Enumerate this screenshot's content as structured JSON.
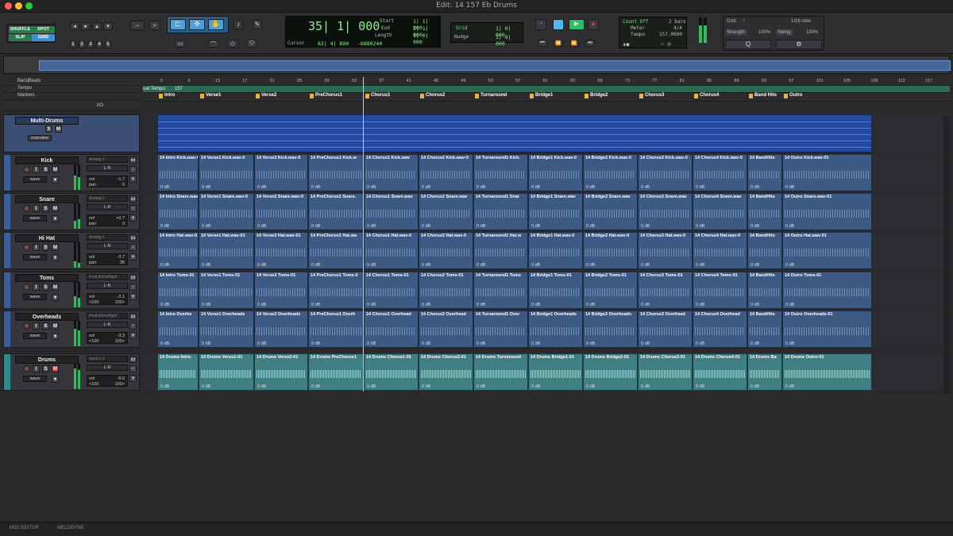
{
  "window": {
    "title": "Edit: 14 157 Eb Drums"
  },
  "modes": [
    "SHUFFLE",
    "SPOT",
    "SLIP",
    "GRID"
  ],
  "grid_numbers": [
    "1",
    "2",
    "3",
    "4",
    "5"
  ],
  "counter": {
    "main": "35| 1| 000",
    "start_label": "Start",
    "start": "1| 1| 000",
    "end_label": "End",
    "end": "2| 1| 000",
    "length_label": "Length",
    "length": "1| 0| 000",
    "cursor_label": "Cursor",
    "cursor_val": "62| 4| 890",
    "sample": "-6880244"
  },
  "grid": {
    "label": "Grid",
    "value": "1| 0| 000",
    "nudge_label": "Nudge",
    "nudge_value": "1| 0| 000"
  },
  "transport": {
    "count_off": "Count Off",
    "bars": "2 bars",
    "meter_label": "Meter",
    "meter": "4/4",
    "tempo_label": "Tempo",
    "tempo": "157.0000"
  },
  "quantize": {
    "grid_label": "Grid:",
    "grid_value": "1/16 note",
    "strength_label": "Strength:",
    "strength": "100%",
    "swing_label": "Swing:",
    "swing": "100%"
  },
  "rulers": {
    "bars_beats": "Bars|Beats",
    "tempo": "Tempo",
    "markers": "Markers",
    "tempo_text": "ual Tempo:",
    "tempo_val": "157"
  },
  "bar_numbers": [
    "5",
    "9",
    "13",
    "17",
    "21",
    "25",
    "29",
    "33",
    "37",
    "41",
    "45",
    "49",
    "53",
    "57",
    "61",
    "65",
    "69",
    "73",
    "77",
    "81",
    "85",
    "89",
    "93",
    "97",
    "101",
    "105",
    "109",
    "113",
    "117"
  ],
  "markers": [
    "Intro",
    "Verse1",
    "Verse2",
    "PreChorus1",
    "Chorus1",
    "Chorus2",
    "Turnaround",
    "Bridge1",
    "Bridge2",
    "Chorus3",
    "Chorus4",
    "Band Hits",
    "Outro"
  ],
  "io_label": "I/O",
  "folder": {
    "name": "Multi-Drums",
    "view": "overview"
  },
  "tracks": [
    {
      "name": "Kick",
      "input": "Analog 1",
      "out": "L-R",
      "vol": "-1.7",
      "pan_label": "pan",
      "pan": "0",
      "mode": "wave",
      "clips": [
        "14 Intro Kick.wav-0",
        "14 Verse1 Kick.wav-0",
        "14 Verse2 Kick.wav-0",
        "14 PreChorus1 Kick.w",
        "14 Chorus1 Kick.wav",
        "14 Chorus2 Kick.wav-0",
        "14 Turnaround1 Kick.",
        "14 Bridge1 Kick.wav-0",
        "14 Bridge2 Kick.wav-0",
        "14 Chorus3 Kick.wav-0",
        "14 Chorus4 Kick.wav-0",
        "14 BandHits",
        "14 Outro Kick.wav-01"
      ]
    },
    {
      "name": "Snare",
      "input": "Analog 1",
      "out": "L-R",
      "vol": "+0.7",
      "pan_label": "pan",
      "pan": "0",
      "mode": "wave",
      "clips": [
        "14 Intro Snare.wav-0",
        "14 Verse1 Snare.wav-0",
        "14 Verse2 Snare.wav-0",
        "14 PreChorus1 Snare.",
        "14 Chorus1 Snare.wav",
        "14 Chorus2 Snare.wav",
        "14 Turnaround1 Snar",
        "14 Bridge1 Snare.wav",
        "14 Bridge2 Snare.wav",
        "14 Chorus3 Snare.wav",
        "14 Chorus4 Snare.wav",
        "14 BandHits",
        "14 Outro Snare.wav-01"
      ]
    },
    {
      "name": "Hi Hat",
      "input": "Analog 1",
      "out": "L-R",
      "vol": "-3.7",
      "pan_label": "pan",
      "pan": "36",
      "mode": "wave",
      "clips": [
        "14 Intro Hat.wav-01",
        "14 Verse1 Hat.wav-01",
        "14 Verse2 Hat.wav-01",
        "14 PreChorus1 Hat.wa",
        "14 Chorus1 Hat.wav-0",
        "14 Chorus2 Hat.wav-0",
        "14 Turnaround1 Hat.w",
        "14 Bridge1 Hat.wav-0",
        "14 Bridge2 Hat.wav-0",
        "14 Chorus3 Hat.wav-0",
        "14 Chorus4 Hat.wav-0",
        "14 BandHits",
        "14 Outro Hat.wav-01"
      ]
    },
    {
      "name": "Toms",
      "input": "FrntLft/FrntRght",
      "out": "L-R",
      "vol": "-2.1",
      "pan_label": "<100",
      "pan": "100>",
      "mode": "wave",
      "clips": [
        "14 Intro Toms-01",
        "14 Verse1 Toms-01",
        "14 Verse2 Toms-01",
        "14 PreChorus1 Toms-0",
        "14 Chorus1 Toms-01",
        "14 Chorus2 Toms-01",
        "14 Turnaround1 Toms",
        "14 Bridge1 Toms-01",
        "14 Bridge2 Toms-01",
        "14 Chorus3 Toms-01",
        "14 Chorus4 Toms-01",
        "14 BandHits",
        "14 Outro Toms-01"
      ]
    },
    {
      "name": "Overheads",
      "input": "FrntLft/FrntRght",
      "out": "L-R",
      "vol": "-3.3",
      "pan_label": "<100",
      "pan": "100>",
      "mode": "wave",
      "clips": [
        "14 Intro Overhe",
        "14 Verse1 Overheads",
        "14 Verse2 Overheads",
        "14 PreChorus1 Overh",
        "14 Chorus1 Overhead",
        "14 Chorus2 Overhead",
        "14 Turnaround1 Over",
        "14 Bridge1 Overheads",
        "14 Bridge2 Overheads",
        "14 Chorus3 Overhead",
        "14 Chorus4 Overhead",
        "14 BandHits",
        "14 Outro Overheads-01"
      ]
    },
    {
      "name": "Drums",
      "input": "Input 1-2",
      "out": "L-R",
      "vol": "-9.0",
      "pan_label": "<100",
      "pan": "100>",
      "mode": "wave",
      "clips": [
        "14 Drums Intro-",
        "14 Drums Verse1-01",
        "14 Drums Verse2-01",
        "14 Drums PreChorus1",
        "14 Drums Chorus1-01",
        "14 Drums Chorus2-01",
        "14 Drums Turnaround",
        "14 Drums Bridge1-01",
        "14 Drums Bridge2-01",
        "14 Drums Chorus3-01",
        "14 Drums Chorus4-01",
        "14 Drums Ba",
        "14 Drums Outro-01"
      ]
    }
  ],
  "clip_gain": "0 dB",
  "bottom": {
    "tab1": "MIDI EDITOR",
    "tab2": "MELODYNE"
  }
}
